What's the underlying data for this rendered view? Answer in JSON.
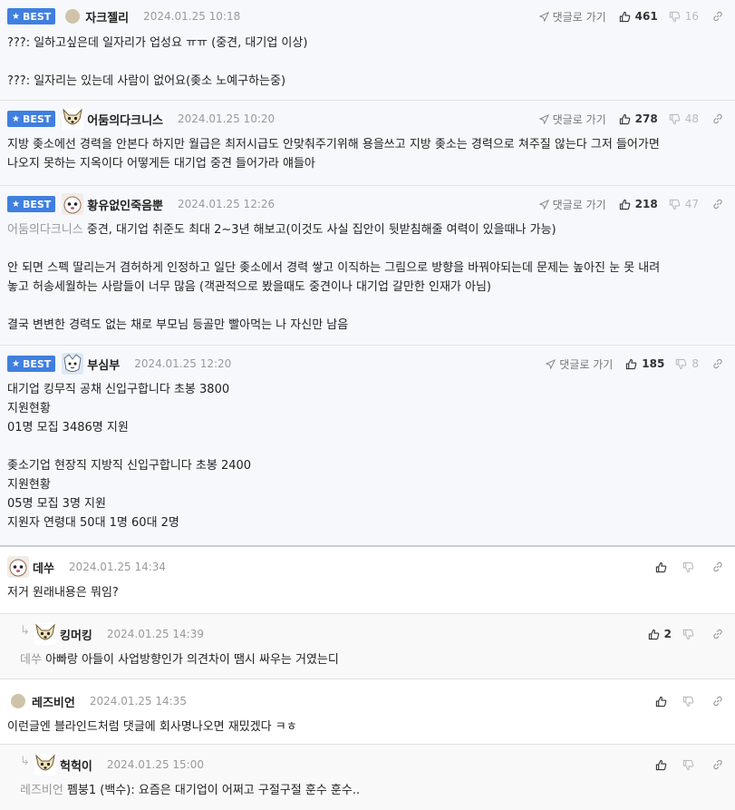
{
  "comments": [
    {
      "best": true,
      "best_label": "BEST",
      "avatar": "dot",
      "nick": "자크젤리",
      "time": "2024.01.25 10:18",
      "goto": "댓글로 가기",
      "likes": "461",
      "dislikes": "16",
      "lines": [
        "???: 일하고싶은데 일자리가 업성요 ㅠㅠ (중견, 대기업 이상)",
        "",
        "???: 일자리는 있는데 사람이 없어요(좆소 노예구하는중)"
      ]
    },
    {
      "best": true,
      "best_label": "BEST",
      "avatar": "dog",
      "nick": "어둠의다크니스",
      "time": "2024.01.25 10:20",
      "goto": "댓글로 가기",
      "likes": "278",
      "dislikes": "48",
      "lines": [
        "지방 좆소에선 경력을 안본다 하지만 월급은 최저시급도 안맞춰주기위해 용을쓰고 지방 좆소는 경력으로 쳐주질 않는다 그저 들어가면",
        "나오지 못하는 지옥이다 어떻게든 대기업 중견 들어가라 얘들아"
      ]
    },
    {
      "best": true,
      "best_label": "BEST",
      "avatar": "dog2",
      "nick": "황유없인죽음뿐",
      "time": "2024.01.25 12:26",
      "goto": "댓글로 가기",
      "likes": "218",
      "dislikes": "47",
      "mention": "어둠의다크니스",
      "lines": [
        "중견, 대기업 취준도 최대 2~3년 해보고(이것도 사실 집안이 뒷받침해줄 여력이 있을때나 가능)",
        "",
        "안 되면 스펙 딸리는거 겸허하게 인정하고 일단 좆소에서 경력 쌓고 이직하는 그림으로 방향을 바꿔야되는데 문제는 높아진 눈 못 내려",
        "놓고 허송세월하는 사람들이 너무 많음 (객관적으로 봤을때도 중견이나 대기업 갈만한 인재가 아님)",
        "",
        "결국 변변한 경력도 없는 채로 부모님 등골만 빨아먹는 나 자신만 남음"
      ]
    },
    {
      "best": true,
      "best_label": "BEST",
      "avatar": "kitty",
      "nick": "부심부",
      "time": "2024.01.25 12:20",
      "goto": "댓글로 가기",
      "likes": "185",
      "dislikes": "8",
      "lines": [
        "대기업 킹무직 공채 신입구합니다 초봉 3800",
        "지원현황",
        "01명 모집 3486명 지원",
        "",
        "좆소기업 현장직 지방직 신입구합니다 초봉 2400",
        "지원현황",
        "05명 모집 3명 지원",
        "지원자 연령대 50대 1명 60대 2명"
      ]
    },
    {
      "best": false,
      "avatar": "dog2",
      "nick": "데쑤",
      "time": "2024.01.25 14:34",
      "likes": "",
      "dislikes": "",
      "lines": [
        "저거 원래내용은 뭐임?"
      ]
    },
    {
      "best": false,
      "reply": true,
      "avatar": "dog",
      "nick": "킹머킹",
      "time": "2024.01.25 14:39",
      "likes": "2",
      "dislikes": "",
      "mention": "데쑤",
      "lines": [
        "아빠랑 아들이 사업방향인가 의견차이 땜시 싸우는 거였는디"
      ]
    },
    {
      "best": false,
      "avatar": "dot",
      "nick": "레즈비언",
      "time": "2024.01.25 14:35",
      "likes": "",
      "dislikes": "",
      "lines": [
        "이런글엔 블라인드처럼 댓글에 회사명나오면 재밌겠다 ㅋㅎ"
      ]
    },
    {
      "best": false,
      "reply": true,
      "avatar": "dog",
      "nick": "헉헉이",
      "time": "2024.01.25 15:00",
      "likes": "",
      "dislikes": "",
      "mention": "레즈비언",
      "lines": [
        "펨붕1 (백수): 요즘은 대기업이 어쩌고 구절구절 훈수 훈수.."
      ]
    }
  ]
}
